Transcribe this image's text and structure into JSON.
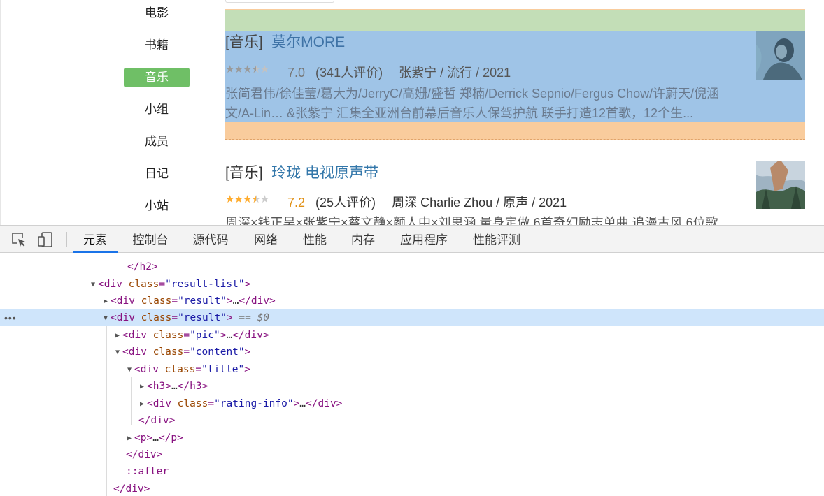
{
  "nav": {
    "items": [
      {
        "label": "电影",
        "active": false
      },
      {
        "label": "书籍",
        "active": false
      },
      {
        "label": "音乐",
        "active": true
      },
      {
        "label": "小组",
        "active": false
      },
      {
        "label": "成员",
        "active": false
      },
      {
        "label": "日记",
        "active": false
      },
      {
        "label": "小站",
        "active": false
      }
    ]
  },
  "results": [
    {
      "type": "[音乐]",
      "title": "莫尔MORE",
      "stars": 3.5,
      "score": "7.0",
      "votes": "(341人评价)",
      "subject": "张紫宁 / 流行 / 2021",
      "desc": "张简君伟/徐佳莹/葛大为/JerryC/高姗/盛哲 郑楠/Derrick Sepnio/Fergus Chow/许蔚天/倪涵文/A-Lin… &张紫宁 汇集全亚洲台前幕后音乐人保驾护航 联手打造12首歌，12个生...",
      "highlighted": true
    },
    {
      "type": "[音乐]",
      "title": "玲珑 电视原声带",
      "stars": 3.5,
      "score": "7.2",
      "votes": "(25人评价)",
      "subject": "周深 Charlie Zhou / 原声 / 2021",
      "desc": "周深×钱正昊×张紫宁×蔡文静×颜人中×刘思涵 量身定做 6首奇幻励志单曲 追漫古风 6位歌",
      "highlighted": false
    }
  ],
  "devtools": {
    "tabs": [
      {
        "label": "元素",
        "active": true
      },
      {
        "label": "控制台",
        "active": false
      },
      {
        "label": "源代码",
        "active": false
      },
      {
        "label": "网络",
        "active": false
      },
      {
        "label": "性能",
        "active": false
      },
      {
        "label": "内存",
        "active": false
      },
      {
        "label": "应用程序",
        "active": false
      },
      {
        "label": "性能评测",
        "active": false
      }
    ],
    "dom": {
      "r0": {
        "close": "</h2>"
      },
      "r1": {
        "tag": "div",
        "attr": "class",
        "val": "\"result-list\""
      },
      "r2": {
        "tag": "div",
        "attr": "class",
        "val": "\"result\"",
        "ellipsis": "…",
        "closetag": "</div>"
      },
      "r3": {
        "tag": "div",
        "attr": "class",
        "val": "\"result\"",
        "marker": "== $0"
      },
      "r4": {
        "tag": "div",
        "attr": "class",
        "val": "\"pic\"",
        "ellipsis": "…",
        "closetag": "</div>"
      },
      "r5": {
        "tag": "div",
        "attr": "class",
        "val": "\"content\""
      },
      "r6": {
        "tag": "div",
        "attr": "class",
        "val": "\"title\""
      },
      "r7": {
        "tag": "h3",
        "ellipsis": "…",
        "closetag": "</h3>"
      },
      "r8": {
        "tag": "div",
        "attr": "class",
        "val": "\"rating-info\"",
        "ellipsis": "…",
        "closetag": "</div>"
      },
      "r9": {
        "close": "</div>"
      },
      "r10": {
        "tag": "p",
        "ellipsis": "…",
        "closetag": "</p>"
      },
      "r11": {
        "close": "</div>"
      },
      "r12": {
        "pseudo": "::after"
      },
      "r13": {
        "close": "</div>"
      }
    },
    "row_menu": "•••"
  },
  "colors": {
    "accent_green": "#6fbf66",
    "link_blue": "#3377aa",
    "star_orange": "#ffac2d",
    "selection_blue": "#cfe5fb",
    "tab_underline": "#1a73e8",
    "highlight_content": "#9fc4e7",
    "highlight_padding": "#c3deb7",
    "highlight_margin": "#f9cc9d"
  }
}
